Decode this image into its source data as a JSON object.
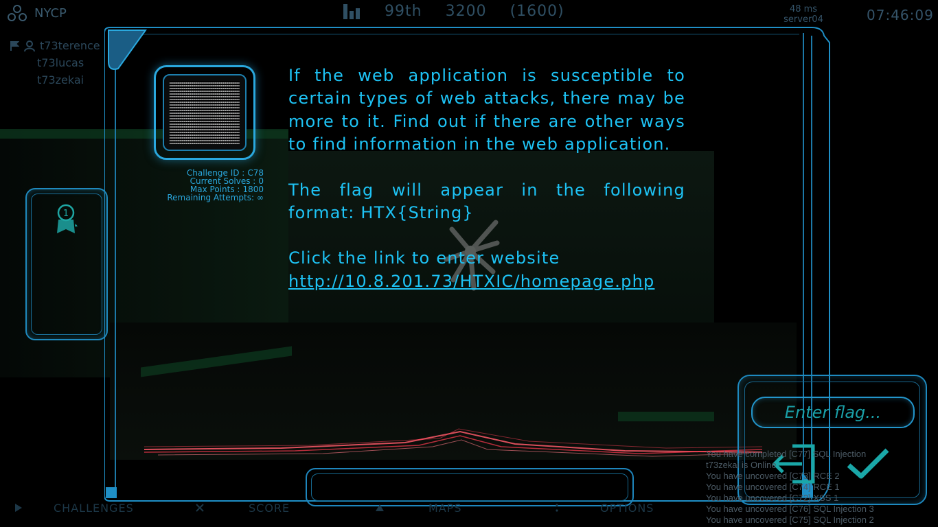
{
  "hud": {
    "team_name": "NYCP",
    "rank": "99th",
    "score": "3200",
    "score_extra": "(1600)",
    "ping": "48 ms",
    "server": "server04",
    "clock": "07:46:09",
    "members": [
      "t73terence",
      "t73lucas",
      "t73zekai"
    ]
  },
  "badge": {
    "number": "1"
  },
  "challenge": {
    "id_label": "Challenge ID :",
    "id_value": "C78",
    "solves_label": "Current Solves :",
    "solves_value": "0",
    "points_label": "Max Points :",
    "points_value": "1800",
    "attempts_label": "Remaining Attempts:",
    "attempts_value": "∞",
    "paragraph1": "If the web application is susceptible to certain types of web attacks, there may be more to it. Find out if there are other ways to find information in the web application.",
    "paragraph2": "The flag will appear in the following format: HTX{String}",
    "paragraph3": "Click the link to enter website",
    "link": "http://10.8.201.73/HTXIC/homepage.php"
  },
  "flag": {
    "placeholder": "Enter flag..."
  },
  "nav": [
    "CHALLENGES",
    "SCORE",
    "MAPS",
    "OPTIONS"
  ],
  "log": [
    "You have completed [C77] SQL Injection",
    "t73zekai is Online",
    "You have uncovered [C73] RCE 2",
    "You have uncovered [C74] RCE 1",
    "You have uncovered [C72] XSS 1",
    "You have uncovered [C76] SQL Injection 3",
    "You have uncovered [C75] SQL Injection 2"
  ],
  "colors": {
    "accent": "#1ec3f5",
    "frame": "#1f8fc6",
    "wave": "#ff5a6a"
  }
}
